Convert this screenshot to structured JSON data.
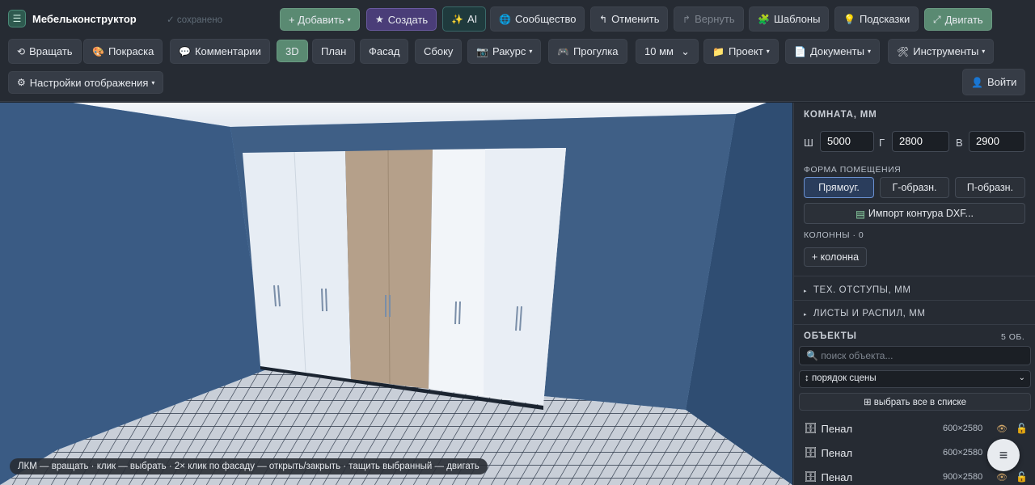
{
  "app": {
    "title": "Мебельконструктор",
    "saved_status": "✓ сохранено",
    "logo_glyph": "☰"
  },
  "toolbar_row1": [
    {
      "id": "add",
      "label": "+ Добавить",
      "caret": "▾",
      "style": "green"
    },
    {
      "id": "create",
      "label": "Создать",
      "icon": "★",
      "style": "purple"
    },
    {
      "id": "ai",
      "label": "AI",
      "icon": "✨",
      "style": "teal"
    },
    {
      "id": "community",
      "label": "Сообщество",
      "icon": "🌐"
    },
    {
      "id": "undo",
      "label": "Отменить",
      "icon": "↰"
    },
    {
      "id": "redo",
      "label": "Вернуть",
      "icon": "↱",
      "disabled": true
    },
    {
      "id": "templates",
      "label": "Шаблоны",
      "icon": "🧩"
    },
    {
      "id": "tips",
      "label": "Подсказки",
      "icon": "💡"
    },
    {
      "id": "move",
      "label": "Двигать",
      "icon": "⤢",
      "style": "green"
    }
  ],
  "toolbar_row2": [
    {
      "id": "rotate",
      "label": "Вращать",
      "icon": "⟲"
    },
    {
      "id": "paint",
      "label": "Покраска",
      "icon": "🎨"
    },
    {
      "id": "comments",
      "label": "Комментарии",
      "icon": "💬"
    },
    {
      "id": "view3d",
      "label": "3D",
      "style": "green"
    },
    {
      "id": "plan",
      "label": "План"
    },
    {
      "id": "facade",
      "label": "Фасад"
    },
    {
      "id": "side",
      "label": "Сбоку"
    },
    {
      "id": "angle",
      "label": "Ракурс",
      "icon": "📷",
      "caret": "▾"
    },
    {
      "id": "walk",
      "label": "Прогулка",
      "icon": "🎮"
    },
    {
      "id": "step",
      "label": "10 мм",
      "caret": "⌄"
    },
    {
      "id": "project",
      "label": "Проект",
      "icon": "📁",
      "caret": "▾"
    },
    {
      "id": "documents",
      "label": "Документы",
      "icon": "📄",
      "caret": "▾"
    },
    {
      "id": "tools",
      "label": "Инструменты",
      "icon": "🛠",
      "caret": "▾"
    }
  ],
  "toolbar_row3": {
    "display_settings": {
      "label": "Настройки отображения",
      "icon": "⚙",
      "caret": "▾"
    },
    "login": {
      "label": "Войти",
      "icon": "👤"
    }
  },
  "viewport": {
    "hint": "ЛКМ — вращать · клик — выбрать · 2× клик по фасаду — открыть/закрыть · тащить выбранный — двигать"
  },
  "panel": {
    "room_title": "КОМНАТА, ММ",
    "dims": [
      {
        "label": "Ш",
        "value": "5000"
      },
      {
        "label": "Г",
        "value": "2800"
      },
      {
        "label": "В",
        "value": "2900"
      }
    ],
    "shape_label": "ФОРМА ПОМЕЩЕНИЯ",
    "shapes": [
      {
        "label": "Прямоуг.",
        "active": true
      },
      {
        "label": "Г-образн.",
        "active": false
      },
      {
        "label": "П-образн.",
        "active": false
      }
    ],
    "import_dxf": {
      "icon": "▤",
      "label": "Импорт контура DXF..."
    },
    "columns_label": "КОЛОННЫ · 0",
    "add_column": "+ колонна",
    "sections": [
      {
        "label": "ТЕХ. ОТСТУПЫ, ММ",
        "marker": "▸"
      },
      {
        "label": "ЛИСТЫ И РАСПИЛ, ММ",
        "marker": "▸"
      }
    ],
    "objects_title": "ОБЪЕКТЫ",
    "objects_count": "5 ОБ.",
    "search_placeholder": "🔍 поиск объекта...",
    "sort_option": "↕ порядок сцены",
    "select_all": "⊞ выбрать все в списке",
    "objects": [
      {
        "icon": "🗄",
        "name": "Пенал",
        "size": "600×2580",
        "eye": "👁",
        "lock": "🔓"
      },
      {
        "icon": "🗄",
        "name": "Пенал",
        "size": "600×2580",
        "eye": "👁",
        "lock": "🔓"
      },
      {
        "icon": "🗄",
        "name": "Пенал",
        "size": "900×2580",
        "eye": "👁",
        "lock": "🔓"
      }
    ]
  },
  "fab_icon": "≡"
}
